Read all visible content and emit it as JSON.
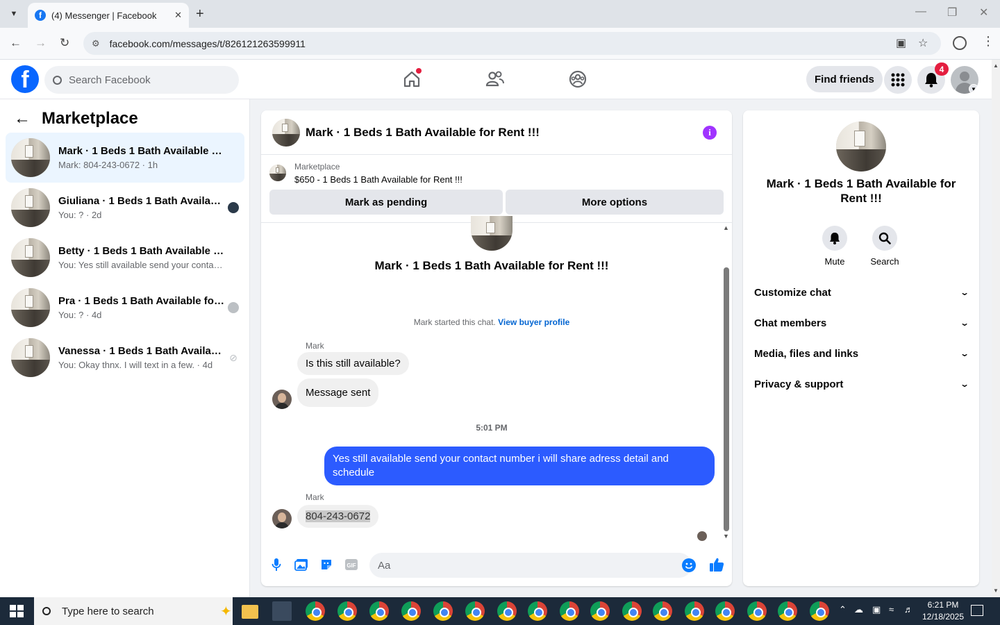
{
  "browser": {
    "tab_title": "(4) Messenger | Facebook",
    "url": "facebook.com/messages/t/826121263599911"
  },
  "fb_header": {
    "search_placeholder": "Search Facebook",
    "find_friends": "Find friends",
    "notification_count": "4"
  },
  "left_pane": {
    "title": "Marketplace",
    "conversations": [
      {
        "name": "Mark · 1 Beds 1 Bath Available for ...",
        "preview": "Mark: 804-243-0672 · 1h"
      },
      {
        "name": "Giuliana · 1 Beds 1 Bath Availabl...",
        "preview": "You: ? · 2d"
      },
      {
        "name": "Betty · 1 Beds 1 Bath Available for ...",
        "preview": "You: Yes still available send your conta... · 4d"
      },
      {
        "name": "Pra · 1 Beds 1 Bath Available for ...",
        "preview": "You: ? · 4d"
      },
      {
        "name": "Vanessa · 1 Beds 1 Bath Available...",
        "preview": "You: Okay thnx. I will text in a few. · 4d"
      }
    ]
  },
  "chat": {
    "title": "Mark · 1 Beds 1 Bath Available for Rent !!!",
    "marketplace_label": "Marketplace",
    "listing": "$650 - 1 Beds 1 Bath Available for Rent !!!",
    "mark_pending": "Mark as pending",
    "more_options": "More options",
    "intro_name": "Mark · 1 Beds 1 Bath Available for Rent !!!",
    "started_text": "Mark started this chat.",
    "view_buyer": "View buyer profile",
    "sender1": "Mark",
    "msg1": "Is this still available?",
    "msg2": "Message sent",
    "timestamp": "5:01 PM",
    "msg_out": "Yes still available send your contact number i will share adress detail and schedule",
    "sender2": "Mark",
    "msg3": "804-243-0672",
    "composer_placeholder": "Aa"
  },
  "right_panel": {
    "name": "Mark · 1 Beds 1 Bath Available for Rent !!!",
    "mute": "Mute",
    "search": "Search",
    "sections": [
      "Customize chat",
      "Chat members",
      "Media, files and links",
      "Privacy & support"
    ]
  },
  "taskbar": {
    "search_placeholder": "Type here to search",
    "time": "6:21 PM",
    "date": "12/18/2025"
  },
  "colors": {
    "fb_blue": "#0866ff",
    "outgoing_bubble": "#2c5bff",
    "link": "#0064d1",
    "active_row": "#ebf5ff",
    "info_icon": "#a033ff"
  }
}
